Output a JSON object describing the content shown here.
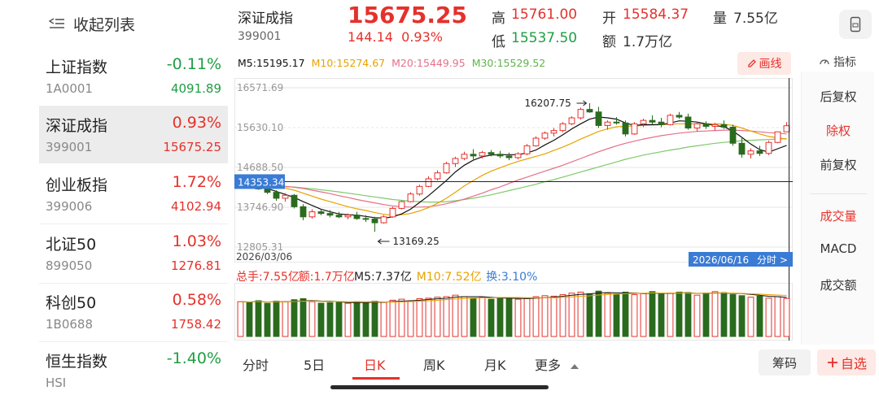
{
  "sidebar": {
    "collapse_label": "收起列表",
    "items": [
      {
        "name": "上证指数",
        "code": "1A0001",
        "pct": "-0.11%",
        "val": "4091.89",
        "dir": "down"
      },
      {
        "name": "深证成指",
        "code": "399001",
        "pct": "0.93%",
        "val": "15675.25",
        "dir": "up",
        "active": true
      },
      {
        "name": "创业板指",
        "code": "399006",
        "pct": "1.72%",
        "val": "4102.94",
        "dir": "up"
      },
      {
        "name": "北证50",
        "code": "899050",
        "pct": "1.03%",
        "val": "1276.81",
        "dir": "up"
      },
      {
        "name": "科创50",
        "code": "1B0688",
        "pct": "0.58%",
        "val": "1758.42",
        "dir": "up"
      },
      {
        "name": "恒生指数",
        "code": "HSI",
        "pct": "-1.40%",
        "val": "",
        "dir": "down"
      }
    ]
  },
  "header": {
    "name": "深证成指",
    "code": "399001",
    "price": "15675.25",
    "change": "144.14",
    "change_pct": "0.93%",
    "high_label": "高",
    "high": "15761.00",
    "low_label": "低",
    "low": "15537.50",
    "open_label": "开",
    "open": "15584.37",
    "amount_label": "额",
    "amount": "1.7万亿",
    "volume_label": "量",
    "volume": "7.55亿"
  },
  "ma": {
    "m5": "M5:15195.17",
    "m10": "M10:15274.67",
    "m20": "M20:15449.95",
    "m30": "M30:15529.52"
  },
  "toolbar": {
    "draw_label": "画线",
    "indicator_label": "指标"
  },
  "chart": {
    "y_ticks": [
      "16571.69",
      "15630.10",
      "14688.50",
      "13746.90",
      "12805.31"
    ],
    "crosshair_price": "14353.34",
    "start_date": "2026/03/06",
    "crosshair_date": "2026/06/16",
    "timeshare_label": "分时 >",
    "high_annotation": "16207.75",
    "low_annotation": "13169.25"
  },
  "volume": {
    "total": "总手:7.55亿",
    "amount": "额:1.7万亿",
    "m5": "M5:7.37亿",
    "m10": "M10:7.52亿",
    "turnover_label": "换:",
    "turnover": "3.10%"
  },
  "right_panel": {
    "options": [
      "后复权",
      "除权",
      "前复权"
    ],
    "selected": "除权",
    "indicators": [
      "成交量",
      "MACD",
      "成交额"
    ],
    "indicator_selected": "成交量"
  },
  "tabs": [
    "分时",
    "5日",
    "日K",
    "周K",
    "月K",
    "更多"
  ],
  "selected_tab": "日K",
  "actions": {
    "chip": "筹码",
    "watch": "自选"
  },
  "colors": {
    "up": "#e5312b",
    "down": "#2a6b1e",
    "ma5": "#111111",
    "ma10": "#e8a300",
    "ma20": "#e4708a",
    "ma30": "#7fc96a",
    "accent_blue": "#3a7bd5"
  },
  "chart_data": {
    "type": "candlestick",
    "y_range": [
      12805.31,
      16571.69
    ],
    "candles": [
      [
        14290,
        14380,
        14200,
        14330
      ],
      [
        14330,
        14420,
        14240,
        14270
      ],
      [
        14270,
        14350,
        14160,
        14180
      ],
      [
        14180,
        14260,
        14060,
        14100
      ],
      [
        14100,
        14150,
        13900,
        13960
      ],
      [
        13960,
        14080,
        13880,
        14030
      ],
      [
        14030,
        14060,
        13720,
        13760
      ],
      [
        13760,
        13820,
        13440,
        13520
      ],
      [
        13520,
        13700,
        13480,
        13640
      ],
      [
        13640,
        13700,
        13560,
        13600
      ],
      [
        13600,
        13680,
        13510,
        13560
      ],
      [
        13560,
        13640,
        13490,
        13520
      ],
      [
        13520,
        13600,
        13460,
        13560
      ],
      [
        13560,
        13640,
        13450,
        13480
      ],
      [
        13480,
        13560,
        13400,
        13470
      ],
      [
        13470,
        13520,
        13169,
        13380
      ],
      [
        13380,
        13560,
        13360,
        13520
      ],
      [
        13520,
        13760,
        13500,
        13720
      ],
      [
        13720,
        13900,
        13700,
        13880
      ],
      [
        13880,
        14100,
        13860,
        14060
      ],
      [
        14060,
        14280,
        14020,
        14240
      ],
      [
        14240,
        14480,
        14220,
        14420
      ],
      [
        14420,
        14620,
        14380,
        14560
      ],
      [
        14560,
        14820,
        14540,
        14780
      ],
      [
        14780,
        14940,
        14700,
        14900
      ],
      [
        14900,
        15060,
        14860,
        15000
      ],
      [
        15000,
        15120,
        14880,
        14960
      ],
      [
        14960,
        15080,
        14900,
        15040
      ],
      [
        15040,
        15100,
        14950,
        15000
      ],
      [
        15000,
        15080,
        14910,
        14960
      ],
      [
        14960,
        15040,
        14860,
        14920
      ],
      [
        14920,
        15050,
        14880,
        15010
      ],
      [
        15010,
        15240,
        14980,
        15200
      ],
      [
        15200,
        15420,
        15180,
        15380
      ],
      [
        15380,
        15540,
        15340,
        15500
      ],
      [
        15500,
        15620,
        15420,
        15560
      ],
      [
        15560,
        15760,
        15520,
        15720
      ],
      [
        15720,
        15900,
        15690,
        15860
      ],
      [
        15860,
        16100,
        15820,
        16060
      ],
      [
        16060,
        16207,
        15980,
        16000
      ],
      [
        16000,
        16120,
        15620,
        15680
      ],
      [
        15680,
        15800,
        15580,
        15760
      ],
      [
        15760,
        15880,
        15700,
        15740
      ],
      [
        15740,
        15800,
        15420,
        15480
      ],
      [
        15480,
        15760,
        15460,
        15720
      ],
      [
        15720,
        15840,
        15640,
        15800
      ],
      [
        15800,
        15920,
        15700,
        15760
      ],
      [
        15760,
        15860,
        15640,
        15700
      ],
      [
        15700,
        15960,
        15680,
        15920
      ],
      [
        15920,
        16000,
        15840,
        15880
      ],
      [
        15880,
        15960,
        15580,
        15620
      ],
      [
        15620,
        15760,
        15540,
        15720
      ],
      [
        15720,
        15780,
        15600,
        15660
      ],
      [
        15660,
        15740,
        15560,
        15700
      ],
      [
        15700,
        15800,
        15600,
        15640
      ],
      [
        15640,
        15700,
        15200,
        15260
      ],
      [
        15260,
        15400,
        14920,
        15000
      ],
      [
        15000,
        15140,
        14900,
        15080
      ],
      [
        15080,
        15200,
        14960,
        15020
      ],
      [
        15020,
        15320,
        14980,
        15280
      ],
      [
        15280,
        15540,
        15260,
        15530
      ],
      [
        15530,
        15761,
        15537,
        15675
      ]
    ],
    "ma5": [
      14310,
      14280,
      14240,
      14190,
      14120,
      14050,
      13980,
      13880,
      13790,
      13700,
      13640,
      13590,
      13570,
      13560,
      13530,
      13500,
      13490,
      13520,
      13590,
      13700,
      13860,
      14020,
      14200,
      14380,
      14580,
      14740,
      14860,
      14940,
      14980,
      14990,
      14990,
      14990,
      15030,
      15100,
      15220,
      15330,
      15460,
      15600,
      15720,
      15830,
      15880,
      15860,
      15830,
      15740,
      15680,
      15700,
      15700,
      15700,
      15740,
      15790,
      15780,
      15760,
      15720,
      15680,
      15650,
      15550,
      15400,
      15240,
      15110,
      15050,
      15130,
      15210
    ],
    "ma10": [
      14300,
      14300,
      14290,
      14270,
      14240,
      14200,
      14150,
      14080,
      14010,
      13940,
      13880,
      13820,
      13760,
      13710,
      13670,
      13620,
      13580,
      13560,
      13570,
      13600,
      13660,
      13740,
      13840,
      13960,
      14100,
      14250,
      14380,
      14500,
      14600,
      14680,
      14760,
      14830,
      14890,
      14950,
      15010,
      15090,
      15170,
      15260,
      15360,
      15450,
      15540,
      15600,
      15650,
      15660,
      15670,
      15680,
      15690,
      15700,
      15710,
      15720,
      15720,
      15720,
      15720,
      15720,
      15710,
      15680,
      15620,
      15550,
      15480,
      15420,
      15390,
      15360
    ],
    "ma20": [
      14280,
      14280,
      14280,
      14270,
      14260,
      14240,
      14220,
      14190,
      14150,
      14110,
      14070,
      14020,
      13980,
      13930,
      13890,
      13850,
      13810,
      13780,
      13760,
      13750,
      13750,
      13760,
      13790,
      13830,
      13880,
      13940,
      14010,
      14080,
      14160,
      14230,
      14310,
      14390,
      14460,
      14530,
      14600,
      14670,
      14740,
      14820,
      14900,
      14980,
      15060,
      15130,
      15200,
      15260,
      15310,
      15360,
      15400,
      15440,
      15470,
      15500,
      15520,
      15540,
      15550,
      15560,
      15570,
      15570,
      15560,
      15550,
      15530,
      15510,
      15500,
      15480
    ],
    "ma30": [
      14260,
      14260,
      14255,
      14250,
      14245,
      14235,
      14225,
      14205,
      14185,
      14160,
      14135,
      14110,
      14080,
      14050,
      14020,
      13990,
      13960,
      13930,
      13910,
      13890,
      13880,
      13870,
      13870,
      13880,
      13900,
      13930,
      13960,
      14000,
      14040,
      14090,
      14140,
      14190,
      14240,
      14290,
      14350,
      14400,
      14460,
      14520,
      14580,
      14640,
      14700,
      14760,
      14820,
      14880,
      14930,
      14980,
      15020,
      15060,
      15100,
      15130,
      15170,
      15200,
      15230,
      15260,
      15280,
      15300,
      15320,
      15330,
      15340,
      15350,
      15360,
      15370
    ],
    "volumes": [
      6.9,
      6.8,
      7.1,
      6.6,
      7.0,
      6.9,
      7.3,
      7.5,
      6.9,
      6.6,
      6.7,
      6.8,
      6.6,
      6.9,
      6.7,
      7.0,
      6.8,
      7.2,
      7.4,
      7.1,
      7.5,
      7.6,
      7.8,
      7.9,
      8.2,
      7.9,
      7.6,
      7.8,
      7.4,
      7.7,
      7.5,
      7.4,
      7.6,
      7.9,
      8.1,
      8.0,
      8.3,
      8.6,
      8.8,
      8.5,
      9.0,
      8.6,
      8.4,
      8.8,
      8.3,
      8.5,
      8.9,
      8.4,
      8.6,
      8.8,
      8.7,
      8.2,
      8.6,
      8.9,
      8.7,
      8.3,
      8.1,
      7.8,
      8.0,
      7.6,
      7.9,
      7.55
    ],
    "vol_range": [
      0,
      10
    ]
  }
}
